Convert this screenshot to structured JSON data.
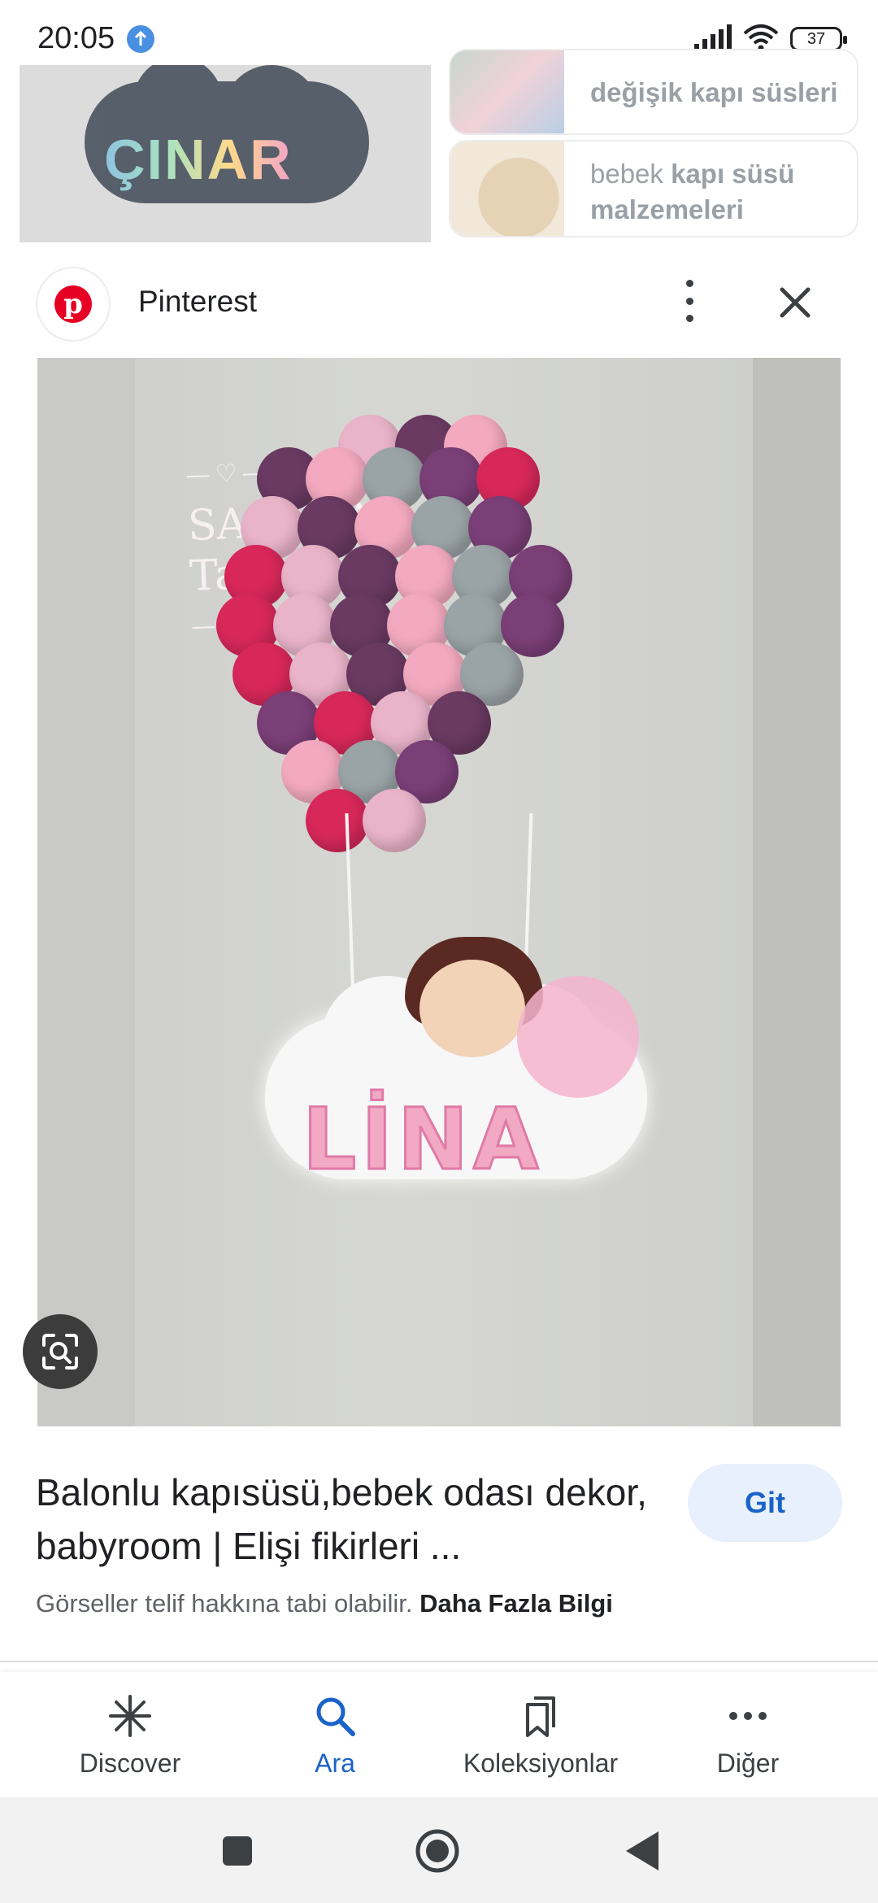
{
  "status_bar": {
    "time": "20:05",
    "battery": "37"
  },
  "related_thumbnails": [
    {
      "text_plain": "",
      "text_bold": "değişik kapı süsleri"
    },
    {
      "text_plain": "bebek ",
      "text_bold": "kapı süsü malzemeleri"
    }
  ],
  "left_thumbnail_text": "ÇINAR",
  "source": {
    "name": "Pinterest",
    "logo_letter": "p"
  },
  "image": {
    "watermark_line1": "SAKURA",
    "watermark_line2": "Tasarım",
    "name_on_cloud": "LİNA"
  },
  "result": {
    "title": "Balonlu kapısüsü,bebek odası dekor, babyroom | Elişi fikirleri ...",
    "go_label": "Git",
    "notice_text": "Görseller telif hakkına tabi olabilir.",
    "notice_link": "Daha Fazla Bilgi"
  },
  "bottom_nav": [
    {
      "label": "Discover",
      "icon": "asterisk-icon",
      "active": false
    },
    {
      "label": "Ara",
      "icon": "search-icon",
      "active": true
    },
    {
      "label": "Koleksiyonlar",
      "icon": "bookmarks-icon",
      "active": false
    },
    {
      "label": "Diğer",
      "icon": "more-horizontal-icon",
      "active": false
    }
  ],
  "colors": {
    "accent": "#1a63c8",
    "pinterest_red": "#e60023",
    "go_button_bg": "#e8f0fe"
  }
}
